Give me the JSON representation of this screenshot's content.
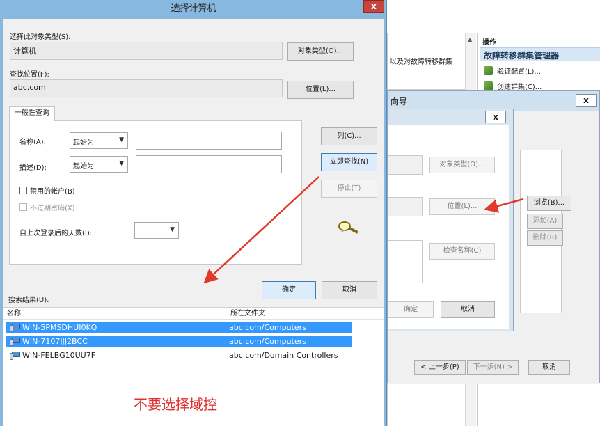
{
  "background_window": {
    "text_fragment": "以及对故障转移群集",
    "actions_pane": {
      "title": "操作",
      "header": "故障转移群集管理器",
      "items": [
        {
          "label": "验证配置(L)...",
          "icon": "validate-icon"
        },
        {
          "label": "创建群集(C)...",
          "icon": "cluster-icon"
        }
      ]
    }
  },
  "wizard": {
    "title_fragment": "向导",
    "close_label": "x",
    "browse_label": "浏览(B)...",
    "add_label": "添加(A)",
    "remove_label": "删除(R)",
    "prev_label": "< 上一步(P)",
    "next_label": "下一步(N) >",
    "cancel_label": "取消"
  },
  "inner_dialog": {
    "close_label": "x",
    "object_types_label": "对象类型(O)...",
    "locations_label": "位置(L)...",
    "check_names_label": "检查名称(C)",
    "ok_label": "确定",
    "cancel_label": "取消"
  },
  "dialog": {
    "title": "选择计算机",
    "close_label": "x",
    "object_type_label": "选择此对象类型(S):",
    "object_type_value": "计算机",
    "object_types_button": "对象类型(O)...",
    "location_label": "查找位置(F):",
    "location_value": "abc.com",
    "locations_button": "位置(L)...",
    "tab_label": "一般性查询",
    "name_label": "名称(A):",
    "name_mode": "起始为",
    "desc_label": "描述(D):",
    "desc_mode": "起始为",
    "disabled_accounts": "禁用的帐户(B)",
    "non_expiring": "不过期密码(X)",
    "days_since_logon": "自上次登录后的天数(I):",
    "columns_button": "列(C)...",
    "find_now_button": "立即查找(N)",
    "stop_button": "停止(T)",
    "ok_button": "确定",
    "cancel_button": "取消",
    "results_label": "搜索结果(U):",
    "results_headers": [
      "名称",
      "所在文件夹"
    ],
    "results": [
      {
        "name": "WIN-5PMSDHUI0KQ",
        "folder": "abc.com/Computers",
        "selected": true
      },
      {
        "name": "WIN-7107JJJ2BCC",
        "folder": "abc.com/Computers",
        "selected": true
      },
      {
        "name": "WIN-FELBG10UU7F",
        "folder": "abc.com/Domain Controllers",
        "selected": false
      }
    ],
    "annotation": "不要选择域控"
  },
  "colors": {
    "title_bar": "#87b8e0",
    "close_red": "#c7453d",
    "selection": "#3399ff",
    "annotation_red": "#e03030"
  }
}
